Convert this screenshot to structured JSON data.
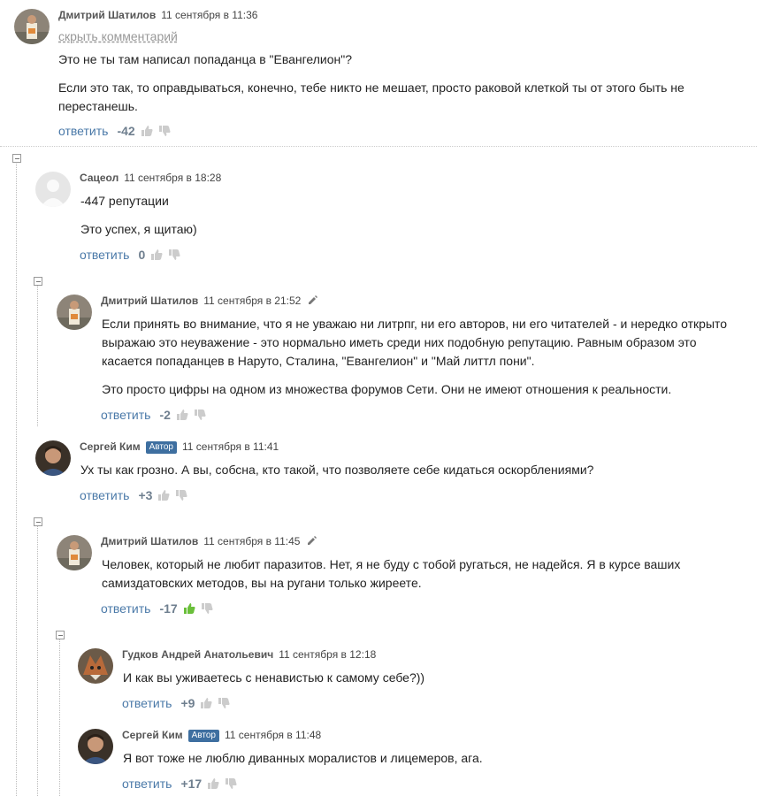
{
  "ui": {
    "reply_label": "ответить",
    "hide_label": "скрыть комментарий"
  },
  "colors": {
    "link": "#4a79a8",
    "score": "#6f7f8f",
    "badge": "#3e6fa0",
    "thumb_active": "#6abf3a"
  },
  "comments": [
    {
      "author": "Дмитрий Шатилов",
      "date": "11 сентября в 11:36",
      "paragraphs": [
        "Это не ты там написал попаданца в \"Евангелион\"?",
        "Если это так, то оправдываться, конечно, тебе никто не мешает, просто раковой клеткой ты от этого быть не",
        "перестанешь."
      ],
      "score": "-42"
    },
    {
      "author": "Сацеол",
      "date": "11 сентября в 18:28",
      "paragraphs": [
        "-447 репутации",
        "Это успех, я щитаю)"
      ],
      "score": "0"
    },
    {
      "author": "Дмитрий Шатилов",
      "date": "11 сентября в 21:52",
      "paragraphs": [
        "Если принять во внимание, что я не уважаю ни литрпг, ни его авторов, ни его читателей - и нередко открыто",
        "выражаю это неуважение - это нормально иметь среди них подобную репутацию. Равным образом это",
        "касается попаданцев в Наруто, Сталина, \"Евангелион\" и \"Май литтл пони\".",
        "Это просто цифры на одном из множества форумов Сети. Они не имеют отношения к реальности."
      ],
      "score": "-2"
    },
    {
      "author": "Сергей Ким",
      "badge": "Автор",
      "date": "11 сентября в 11:41",
      "paragraphs": [
        "Ух ты как грозно. А вы, собсна, кто такой, что позволяете себе кидаться оскорблениями?"
      ],
      "score": "+3"
    },
    {
      "author": "Дмитрий Шатилов",
      "date": "11 сентября в 11:45",
      "paragraphs": [
        "Человек, который не любит паразитов. Нет, я не буду с тобой ругаться, не надейся. Я в курсе ваших",
        "самиздатовских методов, вы на ругани только жиреете."
      ],
      "score": "-17"
    },
    {
      "author": "Гудков Андрей Анатольевич",
      "date": "11 сентября в 12:18",
      "paragraphs": [
        "И как вы уживаетесь с ненавистью к самому себе?))"
      ],
      "score": "+9"
    },
    {
      "author": "Сергей Ким",
      "badge": "Автор",
      "date": "11 сентября в 11:48",
      "paragraphs": [
        "Я вот тоже не люблю диванных моралистов и лицемеров, ага."
      ],
      "score": "+17"
    }
  ]
}
